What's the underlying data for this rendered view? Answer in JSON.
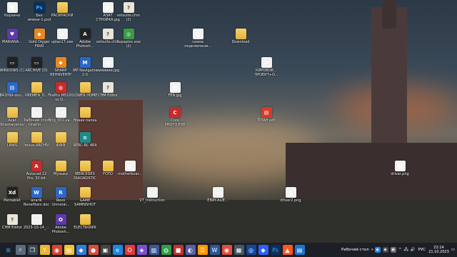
{
  "desktop_icons": [
    {
      "label": "Корзина",
      "icon": "recycle-bin-icon"
    },
    {
      "label": "Без имени-1.psd",
      "icon": "photoshop-file-icon"
    },
    {
      "label": "РАСКРАСКИ",
      "icon": "folder-icon"
    },
    {
      "label": "АЗАТ СТРОЙКА.jpg",
      "icon": "image-file-icon"
    },
    {
      "label": "sotsuite.chm (2)",
      "icon": "chm-file-icon"
    },
    {
      "label": "MARIANA...",
      "icon": "app-icon"
    },
    {
      "label": "Gold Digger FRVR",
      "icon": "game-icon"
    },
    {
      "label": "uplan17.exe",
      "icon": "exe-file-icon"
    },
    {
      "label": "Adobe Photosh...",
      "icon": "adobe-icon"
    },
    {
      "label": "sotsuite.chm",
      "icon": "chm-file-icon"
    },
    {
      "label": "Supaplex.exe (2)",
      "icon": "game-icon"
    },
    {
      "label": "схема подключени...",
      "icon": "image-file-icon"
    },
    {
      "label": "Download",
      "icon": "folder-icon"
    },
    {
      "label": "WINDOWS (C)",
      "icon": "drive-icon"
    },
    {
      "label": "ARCHIVE (D)",
      "icon": "drive-icon"
    },
    {
      "label": "SHARP BEHNVERTP",
      "icon": "app-icon"
    },
    {
      "label": "MP Navigator 2.0",
      "icon": "app-icon"
    },
    {
      "label": "иииииии.jpg",
      "icon": "image-file-icon"
    },
    {
      "label": "КИРОВОК... ПРОЕКТ+О...",
      "icon": "file-icon"
    },
    {
      "label": "842099-dou...",
      "icon": "file-icon"
    },
    {
      "label": "VREMEN_D...",
      "icon": "folder-icon"
    },
    {
      "label": "FirePro M5100 vs Q...",
      "icon": "file-icon"
    },
    {
      "label": "LOWER HOME",
      "icon": "folder-icon"
    },
    {
      "label": "CHM Editor",
      "icon": "chm-file-icon"
    },
    {
      "label": "FEN.jpg",
      "icon": "image-file-icon"
    },
    {
      "label": "Azat Shackarjanov",
      "icon": "folder-icon"
    },
    {
      "label": "Рабочий стол OneDri...",
      "icon": "file-icon"
    },
    {
      "label": "Brig_001-ya...",
      "icon": "file-icon"
    },
    {
      "label": "Новая папка",
      "icon": "folder-icon"
    },
    {
      "label": "Core PHOTO.EXE",
      "icon": "app-icon"
    },
    {
      "label": "ПЛАН.pdf",
      "icon": "pdf-file-icon"
    },
    {
      "label": "LINKS",
      "icon": "folder-icon"
    },
    {
      "label": "lmous ARCHIV",
      "icon": "folder-icon"
    },
    {
      "label": "ФФФ",
      "icon": "folder-icon"
    },
    {
      "label": "APRC-RC 464",
      "icon": "app-icon"
    },
    {
      "label": "Autocad 12 Pro, 32-bit",
      "icon": "app-icon"
    },
    {
      "label": "Музыка",
      "icon": "folder-icon"
    },
    {
      "label": "MERCEDES DIAGNOSTIC",
      "icon": "folder-icon"
    },
    {
      "label": "FOTO",
      "icon": "folder-icon"
    },
    {
      "label": "motherboar...",
      "icon": "image-file-icon"
    },
    {
      "label": "driver.png",
      "icon": "image-file-icon"
    },
    {
      "label": "Pentablet",
      "icon": "app-icon"
    },
    {
      "label": "anarik Benefitani.doc",
      "icon": "word-file-icon"
    },
    {
      "label": "Revo Uninstal...",
      "icon": "app-icon"
    },
    {
      "label": "GAME SAMINSHOT",
      "icon": "folder-icon"
    },
    {
      "label": "V7_Instruction",
      "icon": "file-icon"
    },
    {
      "label": "EBAY-ALIE...",
      "icon": "file-icon"
    },
    {
      "label": "driver2.png",
      "icon": "image-file-icon"
    },
    {
      "label": "CHM Editor",
      "icon": "chm-file-icon"
    },
    {
      "label": "2023-10-14_...",
      "icon": "file-icon"
    },
    {
      "label": "Adobe Photosh...",
      "icon": "adobe-icon"
    },
    {
      "label": "ELECTRONIK",
      "icon": "folder-icon"
    }
  ],
  "taskbar": {
    "tray_label": "Рабочий стол",
    "language": "РУС",
    "time": "22:14",
    "date": "21.10.2023"
  }
}
